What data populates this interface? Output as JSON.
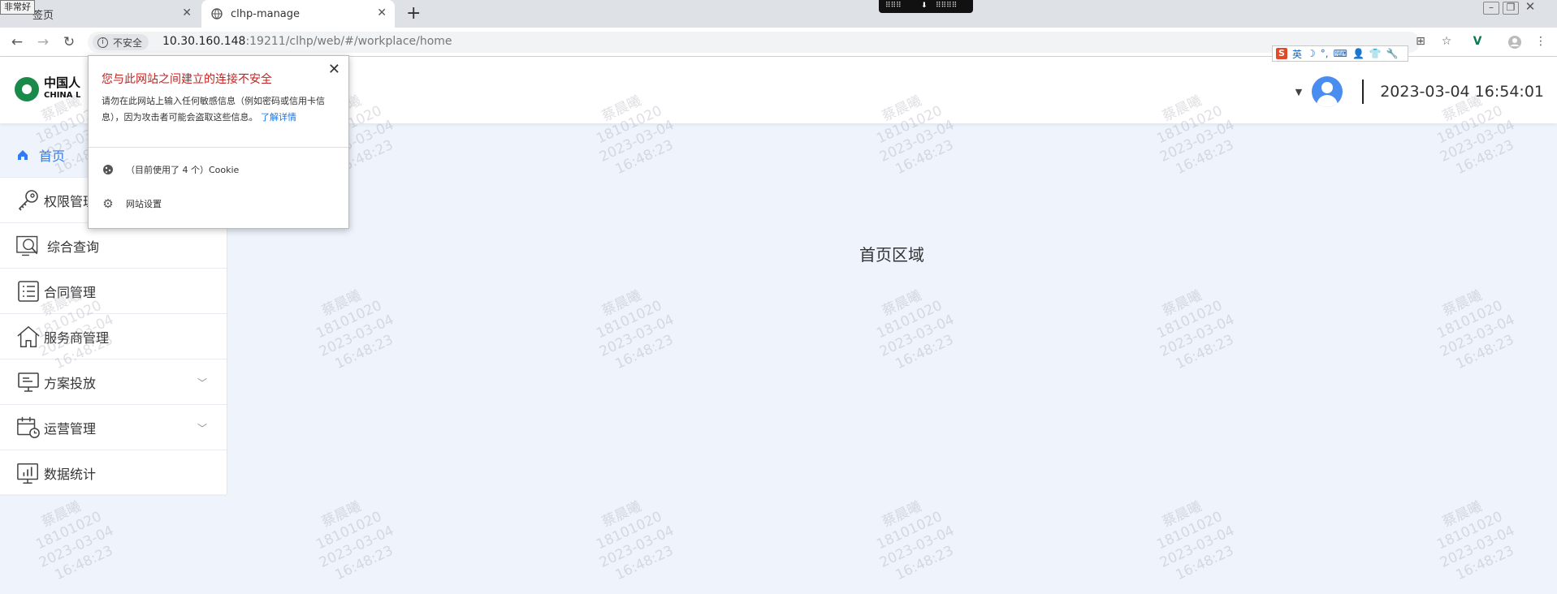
{
  "browser": {
    "fav_label": "非常好",
    "tabs": [
      {
        "label": "签页",
        "active": false
      },
      {
        "label": "clhp-manage",
        "active": true
      }
    ],
    "address": {
      "security_label": "不安全",
      "url_host": "10.30.160.148",
      "url_rest": ":19211/clhp/web/#/workplace/home"
    },
    "ime_bar": {
      "lang": "英",
      "items": [
        "☽",
        "°,",
        "⌨",
        "👤",
        "👕",
        "🔧"
      ]
    }
  },
  "popup": {
    "title": "您与此网站之间建立的连接不安全",
    "body": "请勿在此网站上输入任何敏感信息（例如密码或信用卡信息），因为攻击者可能会盗取这些信息。",
    "link": "了解详情",
    "cookie_label": "（目前使用了 4 个）Cookie",
    "settings_label": "网站设置"
  },
  "header": {
    "logo_cn": "中国人",
    "logo_en": "CHINA L",
    "datetime": "2023-03-04 16:54:01"
  },
  "sidebar": {
    "items": [
      {
        "label": "首页",
        "icon": "home-icon",
        "active": true,
        "expandable": false
      },
      {
        "label": "权限管理",
        "icon": "key-icon",
        "active": false,
        "expandable": false
      },
      {
        "label": "综合查询",
        "icon": "search-monitor-icon",
        "active": false,
        "expandable": false
      },
      {
        "label": "合同管理",
        "icon": "list-icon",
        "active": false,
        "expandable": false
      },
      {
        "label": "服务商管理",
        "icon": "house-icon",
        "active": false,
        "expandable": false
      },
      {
        "label": "方案投放",
        "icon": "monitor-icon",
        "active": false,
        "expandable": true
      },
      {
        "label": "运营管理",
        "icon": "calendar-clock-icon",
        "active": false,
        "expandable": true
      },
      {
        "label": "数据统计",
        "icon": "chart-icon",
        "active": false,
        "expandable": false
      }
    ]
  },
  "main": {
    "title": "首页区域"
  },
  "watermark": {
    "name": "蔡晨曦",
    "id": "18101020",
    "date": "2023-03-04",
    "time": "16:48:23"
  },
  "colors": {
    "accent": "#2f7df6",
    "warning": "#c5221f",
    "background": "#eef3fc"
  }
}
